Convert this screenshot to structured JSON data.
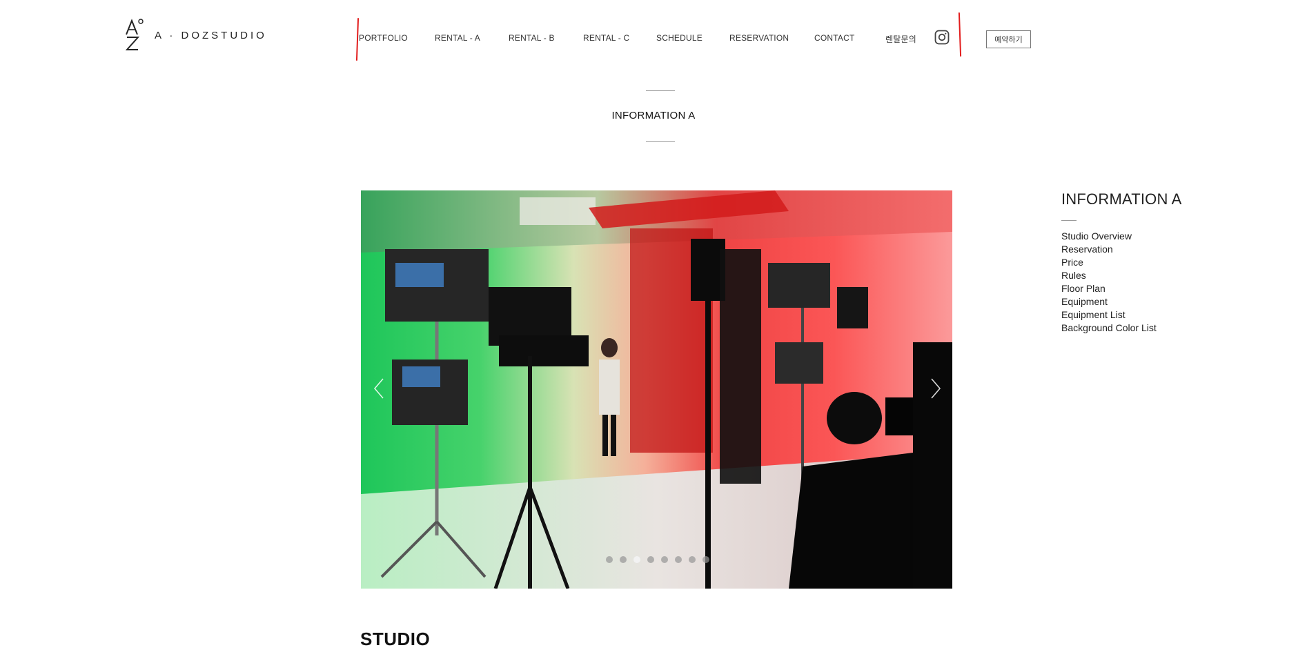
{
  "brand": {
    "name": "A · DOZSTUDIO",
    "logo_letters": "AZ"
  },
  "nav": {
    "items": [
      {
        "label": "PORTFOLIO"
      },
      {
        "label": "RENTAL - A"
      },
      {
        "label": "RENTAL - B"
      },
      {
        "label": "RENTAL - C"
      },
      {
        "label": "SCHEDULE"
      },
      {
        "label": "RESERVATION"
      },
      {
        "label": "CONTACT"
      },
      {
        "label": "렌탈문의"
      }
    ],
    "instagram_icon": "instagram-icon",
    "reserve_button": "예약하기"
  },
  "page": {
    "title": "INFORMATION A"
  },
  "slideshow": {
    "slide_count": 8,
    "active_index": 2,
    "prev_icon": "chevron-left-icon",
    "next_icon": "chevron-right-icon"
  },
  "side": {
    "title": "INFORMATION A",
    "links": [
      "Studio Overview",
      "Reservation",
      "Price",
      "Rules",
      "Floor Plan",
      "Equipment",
      "Equipment List",
      "Background Color List"
    ]
  },
  "section": {
    "heading": "STUDIO"
  },
  "colors": {
    "annotation_red": "#e21d1d",
    "text": "#222222",
    "rule": "#9a9a9a"
  }
}
